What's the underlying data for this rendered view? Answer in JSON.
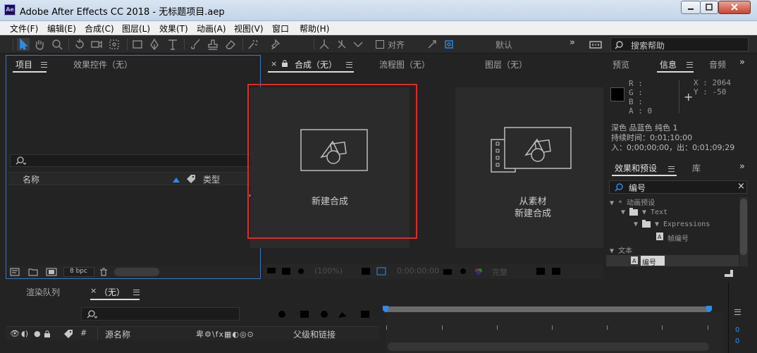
{
  "window": {
    "title": "Adobe After Effects CC 2018 - 无标题项目.aep",
    "app_icon": "Ae"
  },
  "menu": {
    "items": [
      {
        "label": "文件(F)"
      },
      {
        "label": "编辑(E)"
      },
      {
        "label": "合成(C)"
      },
      {
        "label": "图层(L)"
      },
      {
        "label": "效果(T)"
      },
      {
        "label": "动画(A)"
      },
      {
        "label": "视图(V)"
      },
      {
        "label": "窗口"
      },
      {
        "label": "帮助(H)"
      }
    ]
  },
  "toolbar": {
    "snap_label": "对齐",
    "workspace_label": "默认",
    "more_label": "»",
    "search_help_placeholder": "搜索帮助"
  },
  "project_panel": {
    "tab_project": "项目",
    "tab_effect_controls": "效果控件（无）",
    "col_name": "名称",
    "col_type": "类型",
    "bpc_label": "8 bpc"
  },
  "viewer": {
    "tab_composition": "合成（无）",
    "tab_flowchart": "流程图（无）",
    "tab_layer": "图层（无）",
    "new_comp_label": "新建合成",
    "from_footage_line1": "从素材",
    "from_footage_line2": "新建合成",
    "zoom_label": "(100%)",
    "timecode": "0:00:00:00",
    "resolution": "完整"
  },
  "info_panel": {
    "tab_preview": "预览",
    "tab_info": "信息",
    "tab_audio": "音频",
    "r_label": "R :",
    "g_label": "G :",
    "b_label": "B :",
    "a_label": "A : 0",
    "x_label": "X : 2064",
    "y_label": "Y : -50",
    "item_name": "深色 品蓝色 纯色 1",
    "duration": "持续时间：0;01;10;00",
    "in_out": "入：0;00;00;00，出：0;01;09;29"
  },
  "effects_panel": {
    "tab_effects": "效果和预设",
    "tab_library": "库",
    "search_value": "编号",
    "tree": [
      {
        "label": "▼ * 动画预设"
      },
      {
        "label": "▼ Text"
      },
      {
        "label": "▼ Expressions"
      },
      {
        "label": "帧编号"
      },
      {
        "label": "▼ 文本"
      },
      {
        "label": "编号"
      }
    ]
  },
  "timeline": {
    "tab_render_queue": "渲染队列",
    "tab_comp": "（无）",
    "col_source_name": "源名称",
    "col_parent": "父级和链接",
    "col_hash": "#",
    "bottom_value_1": "0",
    "bottom_value_2": "0"
  },
  "colors": {
    "accent_blue": "#2d8ceb",
    "highlight_red": "#e12a2a",
    "panel_bg": "#232323"
  }
}
